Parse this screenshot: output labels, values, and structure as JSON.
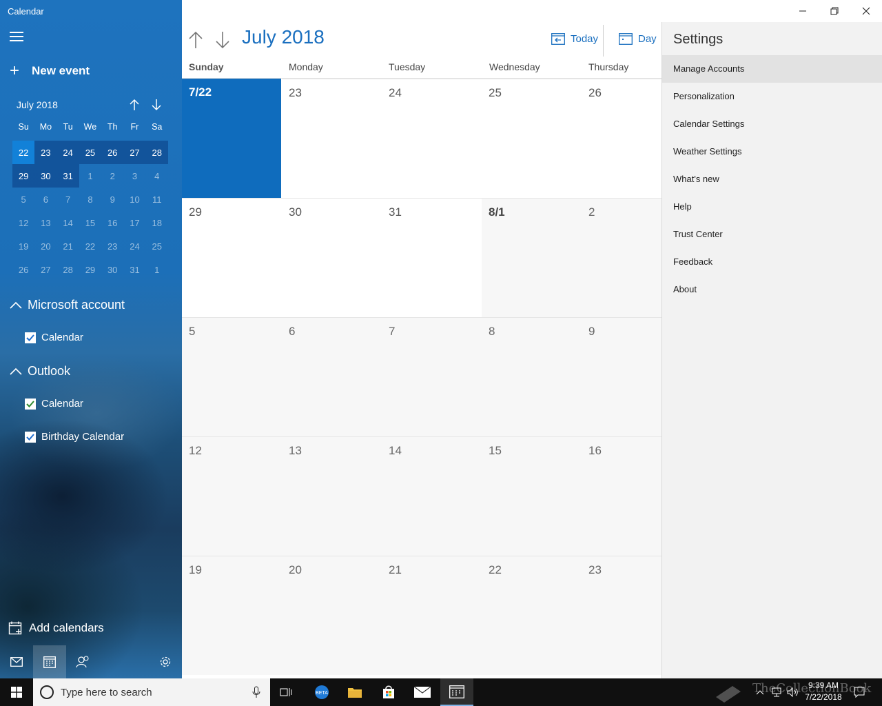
{
  "app": {
    "title": "Calendar"
  },
  "sidebar": {
    "new_event_label": "New event",
    "mini_cal": {
      "month_label": "July 2018",
      "dow": [
        "Su",
        "Mo",
        "Tu",
        "We",
        "Th",
        "Fr",
        "Sa"
      ],
      "weeks": [
        [
          "22",
          "23",
          "24",
          "25",
          "26",
          "27",
          "28"
        ],
        [
          "29",
          "30",
          "31",
          "1",
          "2",
          "3",
          "4"
        ],
        [
          "5",
          "6",
          "7",
          "8",
          "9",
          "10",
          "11"
        ],
        [
          "12",
          "13",
          "14",
          "15",
          "16",
          "17",
          "18"
        ],
        [
          "19",
          "20",
          "21",
          "22",
          "23",
          "24",
          "25"
        ],
        [
          "26",
          "27",
          "28",
          "29",
          "30",
          "31",
          "1"
        ]
      ],
      "today": "22"
    },
    "accounts": [
      {
        "name": "Microsoft account",
        "calendars": [
          {
            "label": "Calendar",
            "checked": true,
            "color": "#1f6fd0"
          }
        ]
      },
      {
        "name": "Outlook",
        "calendars": [
          {
            "label": "Calendar",
            "checked": true,
            "color": "#2e8b2e"
          },
          {
            "label": "Birthday Calendar",
            "checked": true,
            "color": "#1f6fd0"
          }
        ]
      }
    ],
    "add_calendars_label": "Add calendars",
    "bottom_icons": [
      "mail-icon",
      "calendar-icon",
      "people-icon",
      "settings-gear-icon"
    ]
  },
  "calendar": {
    "month_title": "July 2018",
    "today_label": "Today",
    "view_label": "Day",
    "days_of_week": [
      "Sunday",
      "Monday",
      "Tuesday",
      "Wednesday",
      "Thursday"
    ],
    "weeks": [
      [
        "7/22",
        "23",
        "24",
        "25",
        "26"
      ],
      [
        "29",
        "30",
        "31",
        "8/1",
        "2"
      ],
      [
        "5",
        "6",
        "7",
        "8",
        "9"
      ],
      [
        "12",
        "13",
        "14",
        "15",
        "16"
      ],
      [
        "19",
        "20",
        "21",
        "22",
        "23"
      ]
    ]
  },
  "settings": {
    "title": "Settings",
    "items": [
      "Manage Accounts",
      "Personalization",
      "Calendar Settings",
      "Weather Settings",
      "What's new",
      "Help",
      "Trust Center",
      "Feedback",
      "About"
    ],
    "highlighted": "Manage Accounts"
  },
  "taskbar": {
    "search_placeholder": "Type here to search",
    "time": "9:39 AM",
    "date": "7/22/2018",
    "watermark": "TheCollectionBook"
  },
  "colors": {
    "accent": "#0f6cbd",
    "title_blue": "#1a6fbf",
    "settings_bg": "#f2f2f2"
  }
}
